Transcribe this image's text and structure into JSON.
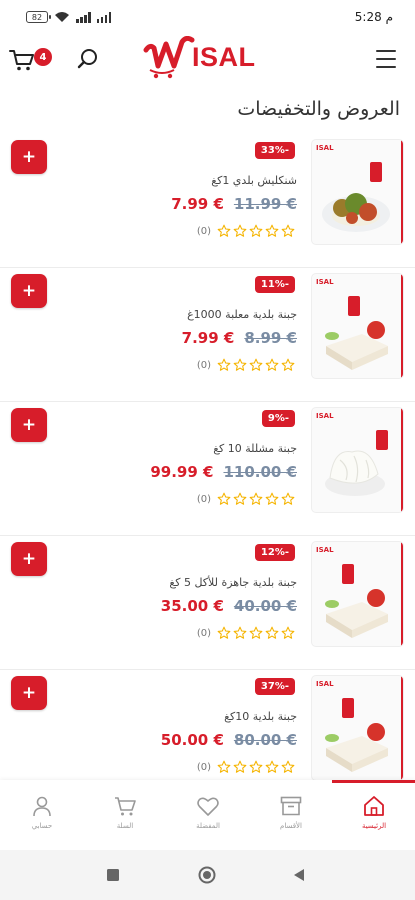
{
  "status_bar": {
    "battery": "82",
    "time": "5:28",
    "time_suffix": "م"
  },
  "header": {
    "cart_count": "4",
    "logo_text": "ISAL",
    "brand_color": "#d71d2a"
  },
  "section_title": "العروض والتخفيضات",
  "products": [
    {
      "discount": "33%-",
      "name": "شنكليش بلدي 1كغ",
      "price_new": "7.99 €",
      "price_old": "11.99 €",
      "rating_count": "(0)",
      "rating": 0,
      "image": "shankleesh"
    },
    {
      "discount": "11%-",
      "name": "جبنة بلدية معلبة 1000غ",
      "price_new": "7.99 €",
      "price_old": "8.99 €",
      "rating_count": "(0)",
      "rating": 0,
      "image": "cheese-block"
    },
    {
      "discount": "9%-",
      "name": "جبنة مشللة 10 كغ",
      "price_new": "99.99 €",
      "price_old": "110.00 €",
      "rating_count": "(0)",
      "rating": 0,
      "image": "string-cheese"
    },
    {
      "discount": "12%-",
      "name": "جبنة بلدية جاهزة للأكل 5 كغ",
      "price_new": "35.00 €",
      "price_old": "40.00 €",
      "rating_count": "(0)",
      "rating": 0,
      "image": "cheese-block"
    },
    {
      "discount": "37%-",
      "name": "جبنة بلدية 10كغ",
      "price_new": "50.00 €",
      "price_old": "80.00 €",
      "rating_count": "(0)",
      "rating": 0,
      "image": "cheese-block"
    }
  ],
  "bottom_nav": [
    {
      "label": "حسابي",
      "icon": "user-icon",
      "active": false
    },
    {
      "label": "السلة",
      "icon": "cart-icon",
      "active": false
    },
    {
      "label": "المفضلة",
      "icon": "heart-icon",
      "active": false
    },
    {
      "label": "الأقسام",
      "icon": "archive-icon",
      "active": false
    },
    {
      "label": "الرئيسية",
      "icon": "home-icon",
      "active": true
    }
  ]
}
